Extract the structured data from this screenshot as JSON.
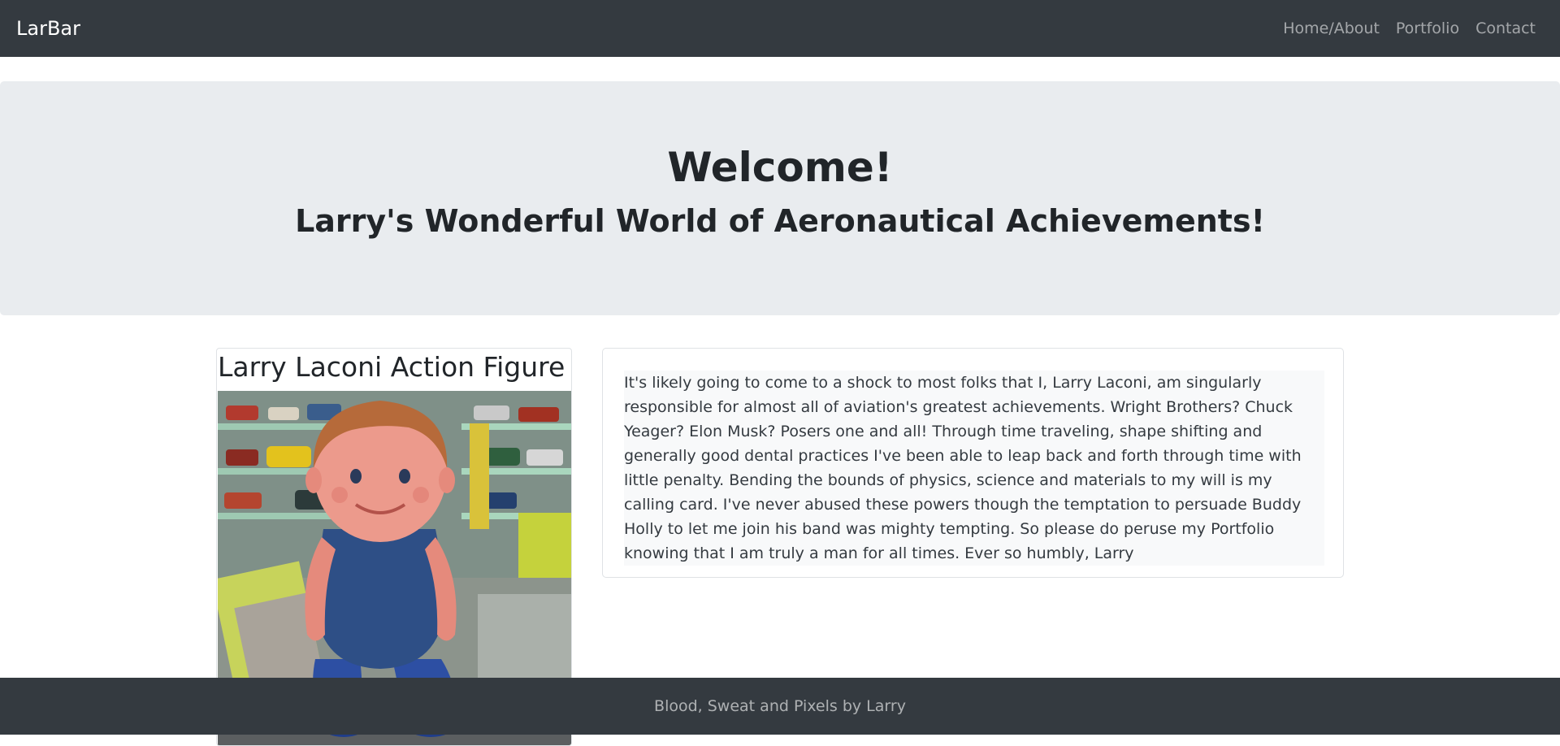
{
  "navbar": {
    "brand": "LarBar",
    "links": [
      {
        "label": "Home/About"
      },
      {
        "label": "Portfolio"
      },
      {
        "label": "Contact"
      }
    ]
  },
  "jumbotron": {
    "title": "Welcome!",
    "subtitle": "Larry's Wonderful World of Aeronautical Achievements!"
  },
  "figure_card": {
    "title": "Larry Laconi Action Figure",
    "image_alt": "doll-photo"
  },
  "bio": {
    "text": "It's likely going to come to a shock to most folks that I, Larry Laconi, am singularly responsible for almost all of aviation's greatest achievements. Wright Brothers? Chuck Yeager? Elon Musk? Posers one and all! Through time traveling, shape shifting and generally good dental practices I've been able to leap back and forth through time with little penalty. Bending the bounds of physics, science and materials to my will is my calling card. I've never abused these powers though the temptation to persuade Buddy Holly to let me join his band was mighty tempting. So please do peruse my Portfolio knowing that I am truly a man for all times. Ever so humbly, Larry"
  },
  "footer": {
    "text": "Blood, Sweat and Pixels by Larry"
  },
  "colors": {
    "navbar_bg": "#343a40",
    "jumbotron_bg": "#e9ecef",
    "text": "#212529"
  }
}
